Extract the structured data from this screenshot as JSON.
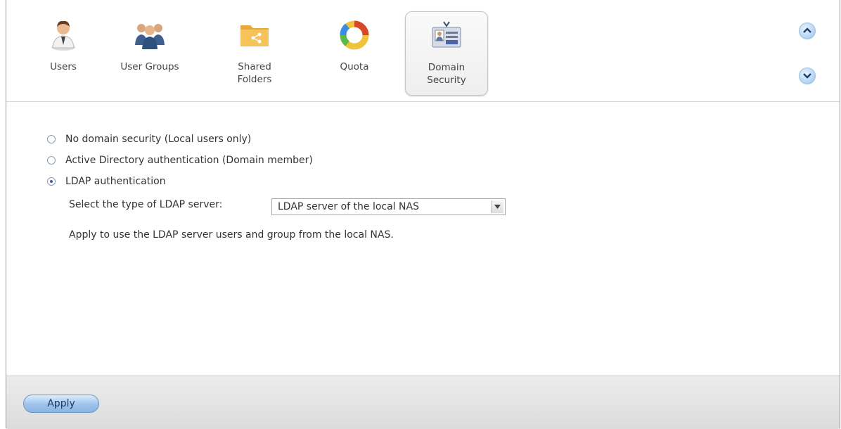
{
  "tabs": [
    {
      "label": "Users",
      "icon": "user-icon",
      "active": false
    },
    {
      "label": "User Groups",
      "icon": "user-group-icon",
      "active": false
    },
    {
      "label": "Shared\nFolders",
      "icon": "shared-folder-icon",
      "active": false
    },
    {
      "label": "Quota",
      "icon": "quota-icon",
      "active": false
    },
    {
      "label": "Domain\nSecurity",
      "icon": "domain-security-icon",
      "active": true
    }
  ],
  "scroll": {
    "up_icon": "chevron-up-icon",
    "down_icon": "chevron-down-icon"
  },
  "options": [
    {
      "label": "No domain security (Local users only)",
      "selected": false
    },
    {
      "label": "Active Directory authentication (Domain member)",
      "selected": false
    },
    {
      "label": "LDAP authentication",
      "selected": true
    }
  ],
  "ldap": {
    "label": "Select the type of LDAP server:",
    "selected": "LDAP server of the local NAS",
    "hint": "Apply to use the LDAP server users and group from the local NAS."
  },
  "footer": {
    "apply_label": "Apply"
  },
  "colors": {
    "accent": "#9dc3ea",
    "radio_dot": "#3a5f8f"
  }
}
